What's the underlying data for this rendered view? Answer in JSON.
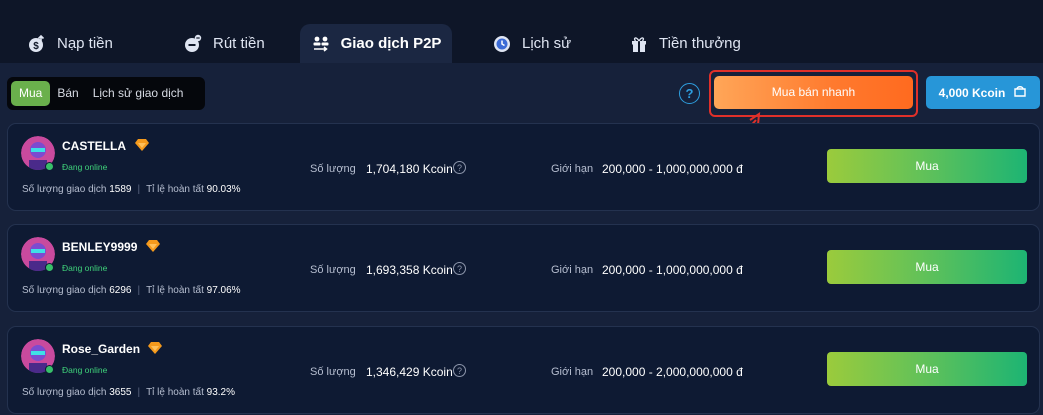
{
  "tabs": [
    {
      "label": "Nạp tiền",
      "icon": "deposit-icon"
    },
    {
      "label": "Rút tiền",
      "icon": "withdraw-icon"
    },
    {
      "label": "Giao dịch P2P",
      "icon": "p2p-icon",
      "active": true
    },
    {
      "label": "Lịch sử",
      "icon": "history-icon"
    },
    {
      "label": "Tiền thưởng",
      "icon": "gift-icon"
    }
  ],
  "segment": {
    "buy": "Mua",
    "sell": "Bán",
    "history": "Lịch sử giao dịch",
    "active": "buy"
  },
  "help_glyph": "?",
  "quick_trade_label": "Mua bán nhanh",
  "balance_label": "4,000 Kcoin",
  "labels": {
    "quantity": "Số lượng",
    "limit": "Giới hạn",
    "trades": "Số lượng giao dịch",
    "completion": "Tỉ lệ hoàn tất",
    "online": "Đang online",
    "buy_button": "Mua",
    "help": "?",
    "separator": "|"
  },
  "colors": {
    "accent_orange": "#ff7a2e",
    "accent_blue": "#2796d8",
    "buy_green": "#5fc15a",
    "online_green": "#3fd27a",
    "highlight_red": "#e0302a"
  },
  "traders": [
    {
      "name": "CASTELLA",
      "trades": "1589",
      "completion": "90.03%",
      "quantity": "1,704,180 Kcoin",
      "limit": "200,000 - 1,000,000,000 đ"
    },
    {
      "name": "BENLEY9999",
      "trades": "6296",
      "completion": "97.06%",
      "quantity": "1,693,358 Kcoin",
      "limit": "200,000 - 1,000,000,000 đ"
    },
    {
      "name": "Rose_Garden",
      "trades": "3655",
      "completion": "93.2%",
      "quantity": "1,346,429 Kcoin",
      "limit": "200,000 - 2,000,000,000 đ"
    }
  ]
}
